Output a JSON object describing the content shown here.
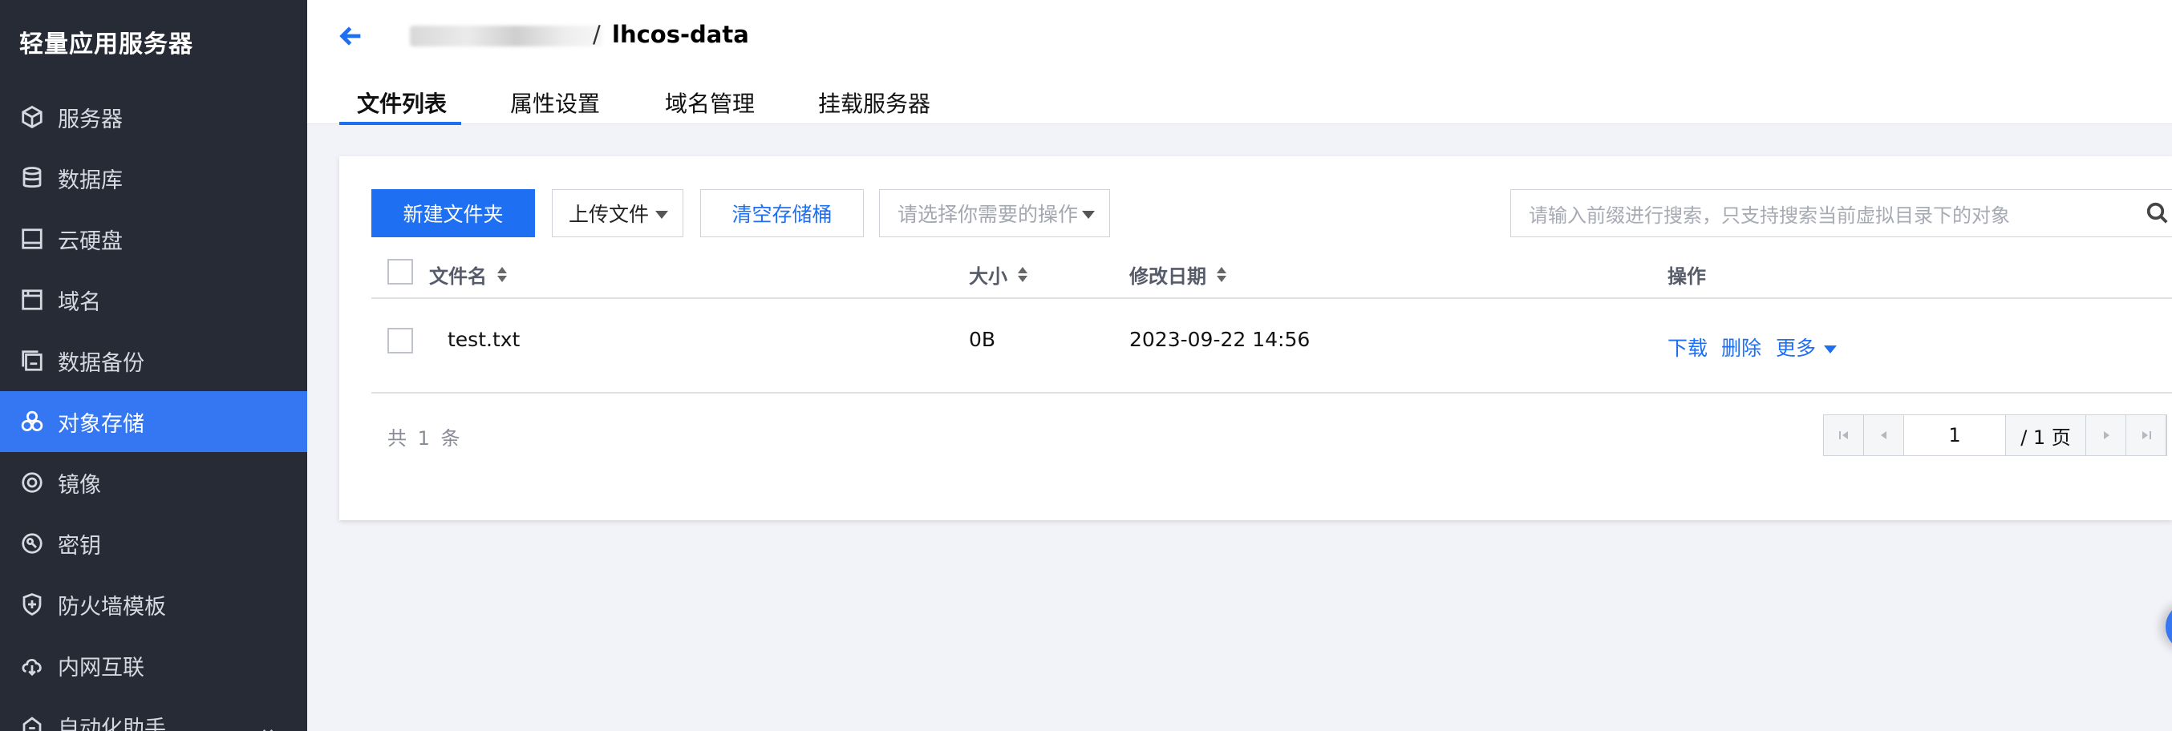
{
  "sidebar": {
    "title": "轻量应用服务器",
    "items": [
      {
        "label": "服务器",
        "icon": "cube-icon"
      },
      {
        "label": "数据库",
        "icon": "database-icon"
      },
      {
        "label": "云硬盘",
        "icon": "disk-icon"
      },
      {
        "label": "域名",
        "icon": "domain-icon"
      },
      {
        "label": "数据备份",
        "icon": "backup-icon"
      },
      {
        "label": "对象存储",
        "icon": "object-storage-icon",
        "active": true
      },
      {
        "label": "镜像",
        "icon": "image-icon"
      },
      {
        "label": "密钥",
        "icon": "key-icon"
      },
      {
        "label": "防火墙模板",
        "icon": "shield-icon"
      },
      {
        "label": "内网互联",
        "icon": "network-icon"
      },
      {
        "label": "自动化助手",
        "icon": "automation-icon"
      }
    ]
  },
  "header": {
    "breadcrumb_separator": "/",
    "bucket_name": "lhcos-data",
    "tabs": [
      {
        "label": "文件列表",
        "active": true
      },
      {
        "label": "属性设置"
      },
      {
        "label": "域名管理"
      },
      {
        "label": "挂载服务器"
      }
    ]
  },
  "toolbar": {
    "new_folder": "新建文件夹",
    "upload": "上传文件",
    "clear_bucket": "清空存储桶",
    "operation_placeholder": "请选择你需要的操作",
    "search_placeholder": "请输入前缀进行搜索，只支持搜索当前虚拟目录下的对象"
  },
  "table": {
    "columns": [
      "文件名",
      "大小",
      "修改日期",
      "操作"
    ],
    "rows": [
      {
        "name": "test.txt",
        "size": "0B",
        "modified": "2023-09-22 14:56",
        "actions": [
          "下载",
          "删除",
          "更多"
        ]
      }
    ]
  },
  "pagination": {
    "total": "共 1 条",
    "current_page": "1",
    "total_pages": "/ 1 页"
  },
  "colors": {
    "accent": "#1e6ff1",
    "sidebar_bg": "#262b36",
    "page_bg": "#f2f3f8"
  }
}
